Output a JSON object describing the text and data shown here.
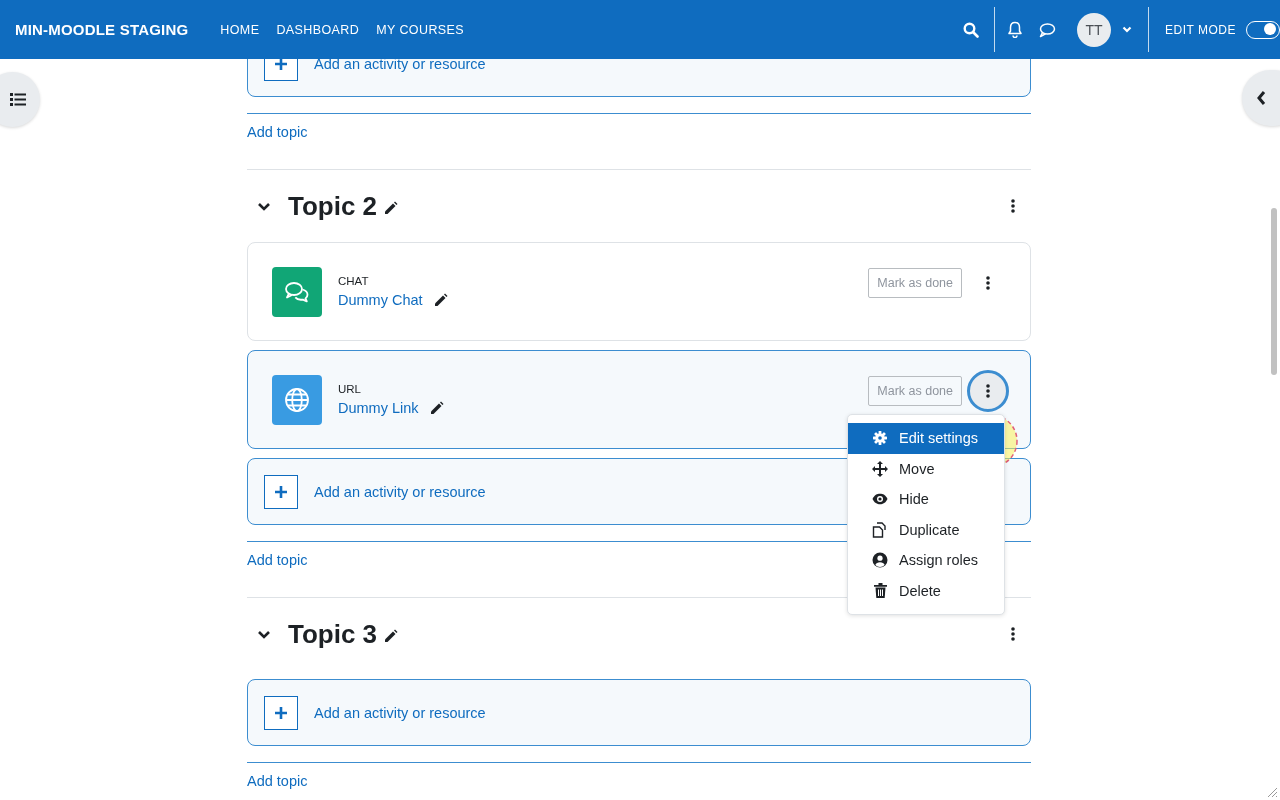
{
  "header": {
    "site_name": "MIN-MOODLE STAGING",
    "nav": [
      {
        "label": "HOME"
      },
      {
        "label": "DASHBOARD"
      },
      {
        "label": "MY COURSES"
      }
    ],
    "avatar": "TT",
    "edit_mode": {
      "label": "EDIT MODE",
      "on": true
    }
  },
  "sections": [
    {
      "kind": "tail",
      "add_activity": "Add an activity or resource",
      "add_topic": "Add topic"
    },
    {
      "kind": "topic",
      "title": "Topic 2",
      "expanded": true,
      "activities": [
        {
          "kind": "chat",
          "type_label": "CHAT",
          "name": "Dummy Chat",
          "completion": "Mark as done",
          "menu_open": false
        },
        {
          "kind": "url",
          "type_label": "URL",
          "name": "Dummy Link",
          "completion": "Mark as done",
          "menu_open": true
        }
      ],
      "add_activity": "Add an activity or resource",
      "add_topic": "Add topic"
    },
    {
      "kind": "topic",
      "title": "Topic 3",
      "expanded": true,
      "add_activity": "Add an activity or resource",
      "add_topic": "Add topic"
    }
  ],
  "action_menu": {
    "items": [
      {
        "kind": "gear",
        "label": "Edit settings",
        "selected": true
      },
      {
        "kind": "move",
        "label": "Move",
        "selected": false
      },
      {
        "kind": "eye",
        "label": "Hide",
        "selected": false
      },
      {
        "kind": "duplicate",
        "label": "Duplicate",
        "selected": false
      },
      {
        "kind": "person",
        "label": "Assign roles",
        "selected": false
      },
      {
        "kind": "trash",
        "label": "Delete",
        "selected": false
      }
    ]
  }
}
